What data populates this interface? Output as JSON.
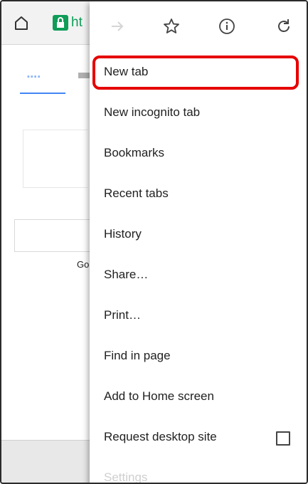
{
  "browser": {
    "url_fragment": "ht",
    "page_fragment": "Go"
  },
  "menu": {
    "icons": [
      "forward-icon",
      "bookmark-star-icon",
      "page-info-icon",
      "reload-icon"
    ],
    "items": [
      {
        "label": "New tab"
      },
      {
        "label": "New incognito tab"
      },
      {
        "label": "Bookmarks"
      },
      {
        "label": "Recent tabs"
      },
      {
        "label": "History"
      },
      {
        "label": "Share…"
      },
      {
        "label": "Print…"
      },
      {
        "label": "Find in page"
      },
      {
        "label": "Add to Home screen"
      },
      {
        "label": "Request desktop site"
      },
      {
        "label": "Settings"
      }
    ],
    "highlight_color": "#e60000"
  }
}
